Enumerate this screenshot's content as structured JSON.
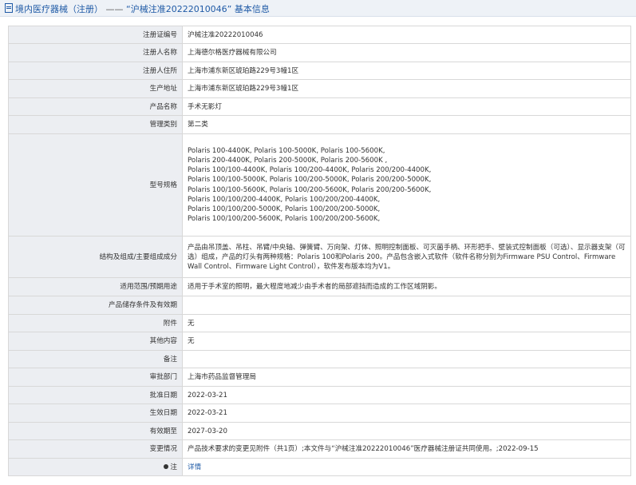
{
  "header": {
    "prefix": "境内医疗器械（注册）",
    "separator": " —— ",
    "record_title": "“沪械注准20222010046” 基本信息"
  },
  "rows": [
    {
      "label": "注册证编号",
      "value": "沪械注准20222010046"
    },
    {
      "label": "注册人名称",
      "value": "上海德尔格医疗器械有限公司"
    },
    {
      "label": "注册人住所",
      "value": "上海市浦东新区琥珀路229号3幢1区"
    },
    {
      "label": "生产地址",
      "value": "上海市浦东新区琥珀路229号3幢1区"
    },
    {
      "label": "产品名称",
      "value": "手术无影灯"
    },
    {
      "label": "管理类别",
      "value": "第二类"
    }
  ],
  "model": {
    "label": "型号规格",
    "lines": [
      "Polaris 100-4400K, Polaris 100-5000K, Polaris 100-5600K,",
      "Polaris 200-4400K, Polaris 200-5000K, Polaris 200-5600K ,",
      "Polaris 100/100-4400K, Polaris 100/200-4400K, Polaris 200/200-4400K,",
      "Polaris 100/100-5000K, Polaris 100/200-5000K, Polaris 200/200-5000K,",
      "Polaris 100/100-5600K, Polaris 100/200-5600K, Polaris 200/200-5600K,",
      "Polaris 100/100/200-4400K, Polaris 100/200/200-4400K,",
      "Polaris 100/100/200-5000K, Polaris 100/200/200-5000K,",
      "Polaris 100/100/200-5600K, Polaris 100/200/200-5600K,"
    ]
  },
  "structure": {
    "label": "结构及组成/主要组成成分",
    "value": "产品由吊顶盖、吊柱、吊臂/中央轴、弹簧臂、万向架、灯体、照明控制面板、可灭菌手柄、环形把手、壁装式控制面板（可选）、显示器支架（可选）组成，产品的灯头有两种规格：Polaris 100和Polaris 200。产品包含嵌入式软件（软件名称分别为Firmware PSU Control、Firmware Wall Control、Firmware Light Control），软件发布版本均为V1。"
  },
  "rows2": [
    {
      "label": "适用范围/预期用途",
      "value": "适用于手术室的照明，最大程度地减少由手术者的局部遮挡而造成的工作区域阴影。"
    },
    {
      "label": "产品储存条件及有效期",
      "value": ""
    },
    {
      "label": "附件",
      "value": "无"
    },
    {
      "label": "其他内容",
      "value": "无"
    },
    {
      "label": "备注",
      "value": ""
    },
    {
      "label": "审批部门",
      "value": "上海市药品监督管理局"
    },
    {
      "label": "批准日期",
      "value": "2022-03-21"
    },
    {
      "label": "生效日期",
      "value": "2022-03-21"
    },
    {
      "label": "有效期至",
      "value": "2027-03-20"
    },
    {
      "label": "变更情况",
      "value": "产品技术要求的变更见附件（共1页）;本文件与“沪械注准20222010046”医疗器械注册证共同使用。;2022-09-15"
    }
  ],
  "note": {
    "label": "注",
    "link_text": "详情"
  }
}
